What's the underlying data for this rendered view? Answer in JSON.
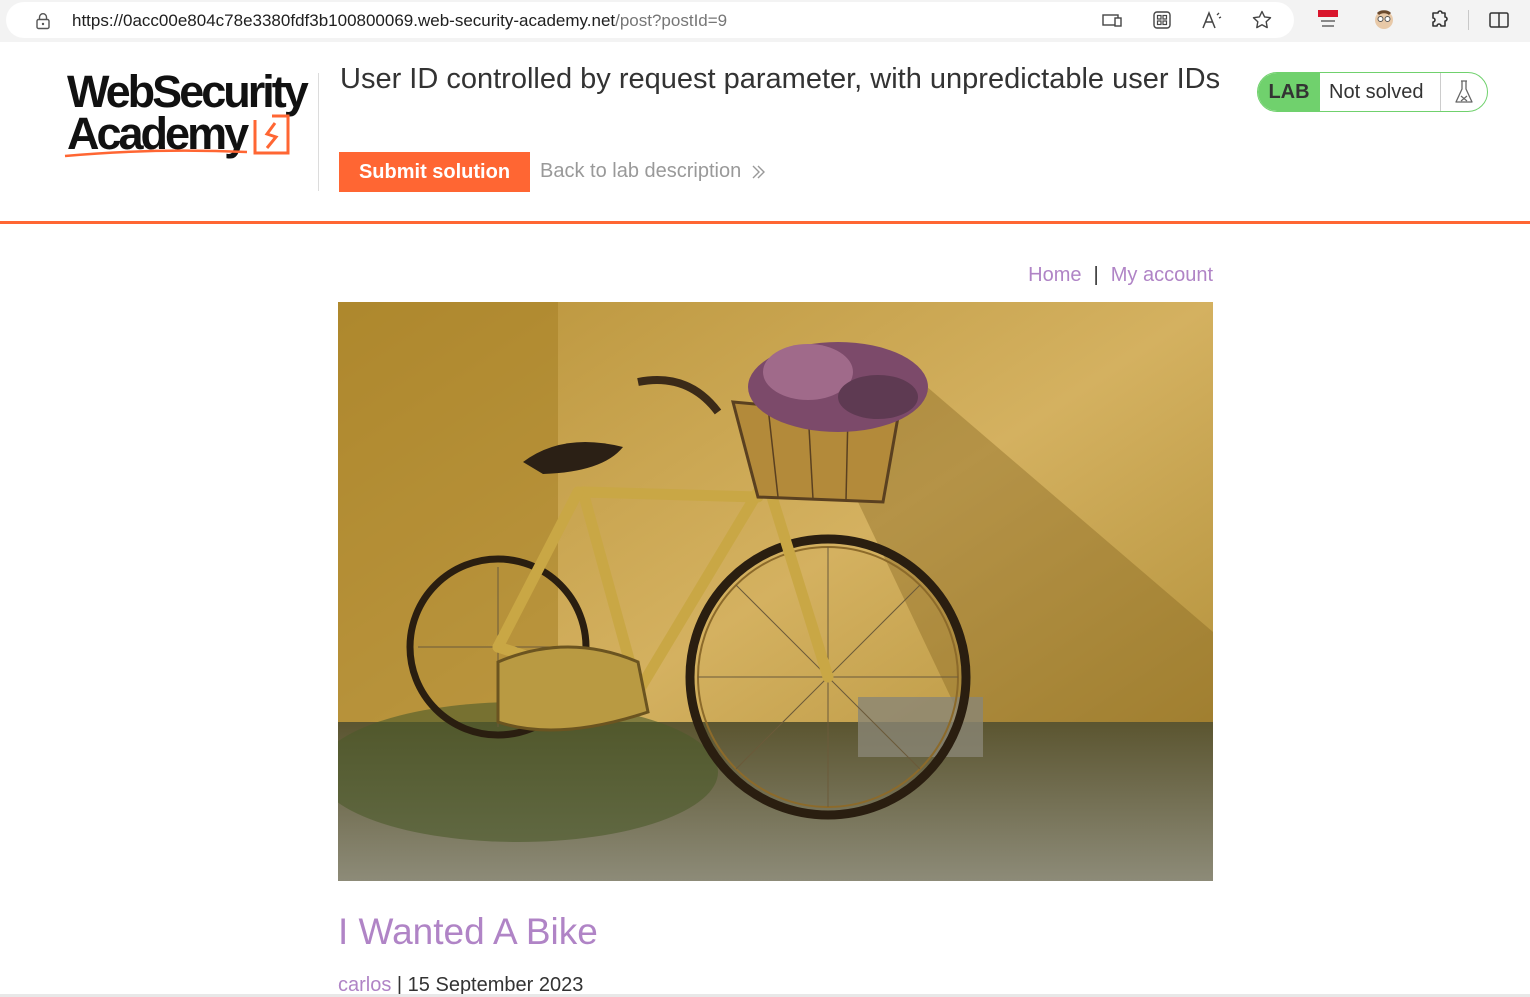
{
  "browser": {
    "url_main": "https://0acc00e804c78e3380fdf3b100800069.web-security-academy.net",
    "url_path": "/post?postId=9",
    "toolbar_icons": [
      "device-icon",
      "apps-icon",
      "read-aloud-icon",
      "favorite-star-icon",
      "extension-badge-icon",
      "profile-icon",
      "extensions-puzzle-icon",
      "split-screen-icon"
    ]
  },
  "header": {
    "logo_line1": "WebSecurity",
    "logo_line2": "Academy",
    "lab_title": "User ID controlled by request parameter, with unpredictable user IDs",
    "submit_label": "Submit solution",
    "back_label": "Back to lab description",
    "badge_lab": "LAB",
    "badge_status": "Not solved"
  },
  "nav": {
    "home": "Home",
    "separator": "|",
    "account": "My account"
  },
  "post": {
    "title": "I Wanted A Bike",
    "author": "carlos",
    "meta_sep": " | ",
    "date": "15 September 2023"
  },
  "colors": {
    "accent": "#ff6633",
    "link": "#b084c6",
    "lab_green": "#70d16d"
  }
}
